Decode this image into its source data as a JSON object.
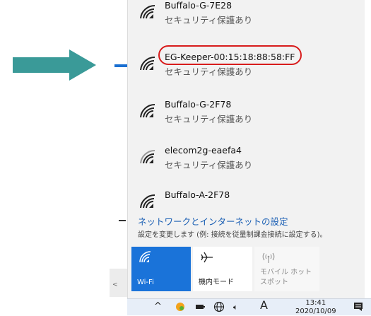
{
  "networks": [
    {
      "name": "Buffalo-G-7E28",
      "security": "セキュリティ保護あり"
    },
    {
      "name": "EG-Keeper-00:15:18:88:58:FF",
      "security": "セキュリティ保護あり"
    },
    {
      "name": "Buffalo-G-2F78",
      "security": "セキュリティ保護あり"
    },
    {
      "name": "elecom2g-eaefa4",
      "security": "セキュリティ保護あり"
    },
    {
      "name": "Buffalo-A-2F78",
      "security": ""
    }
  ],
  "settings": {
    "link": "ネットワークとインターネットの設定",
    "description": "設定を変更します (例: 接続を従量制課金接続に設定する)。"
  },
  "tiles": {
    "wifi": {
      "label": "Wi-Fi",
      "icon": "wifi-icon"
    },
    "airplane": {
      "label": "機内モード",
      "icon": "airplane-icon"
    },
    "mobile_hotspot": {
      "label": "モバイル ホットスポット",
      "icon": "hotspot-icon"
    }
  },
  "taskbar": {
    "ime_mode": "A",
    "time": "13:41",
    "date": "2020/10/09"
  },
  "colors": {
    "arrow": "#3a9a98",
    "highlight": "#d81c1c",
    "accent": "#1a73d9",
    "link": "#1a5fb4"
  }
}
